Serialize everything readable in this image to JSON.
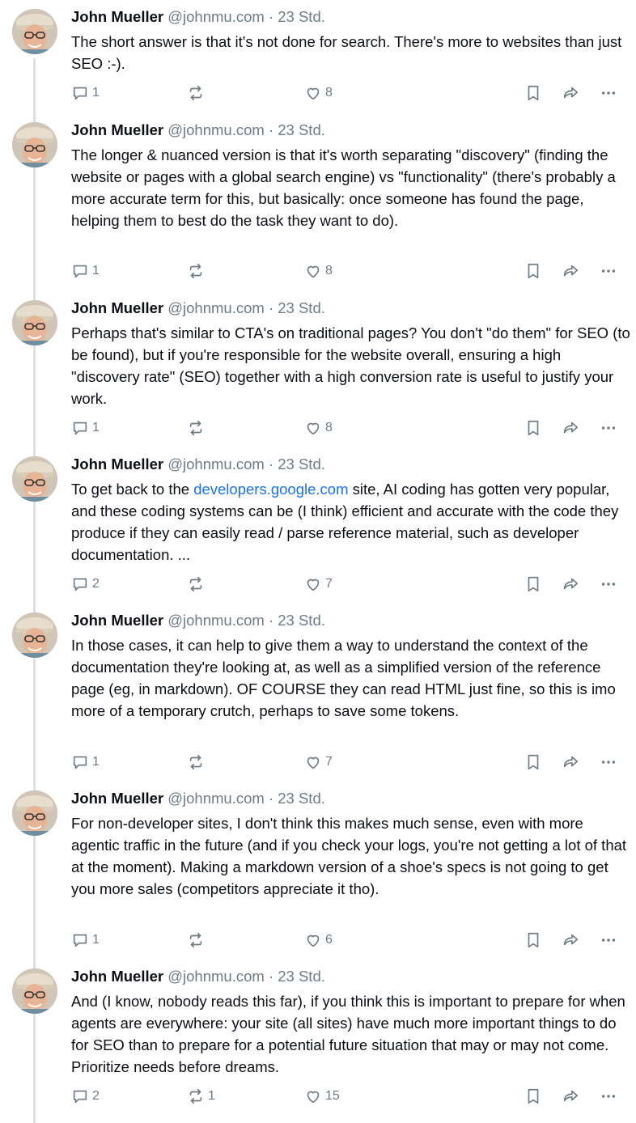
{
  "posts": [
    {
      "author": "John Mueller",
      "handle": "@johnmu.com",
      "separator": "·",
      "time": "23 Std.",
      "text": "The short answer is that it's not done for search. There's more to websites than just SEO :-).",
      "replies": "1",
      "reposts": "",
      "likes": "8"
    },
    {
      "author": "John Mueller",
      "handle": "@johnmu.com",
      "separator": "·",
      "time": "23 Std.",
      "text": "The longer & nuanced version is that it's worth separating \"discovery\" (finding the website or pages with a global search engine) vs \"functionality\" (there's probably a more accurate term for this, but basically: once someone has found the page, helping them to best do the task they want to do).",
      "replies": "1",
      "reposts": "",
      "likes": "8"
    },
    {
      "author": "John Mueller",
      "handle": "@johnmu.com",
      "separator": "·",
      "time": "23 Std.",
      "text": "Perhaps that's similar to CTA's on traditional pages? You don't \"do them\" for SEO (to be found), but if you're responsible for the website overall, ensuring a high \"discovery rate\" (SEO) together with a high conversion rate is useful to justify your work.",
      "replies": "1",
      "reposts": "",
      "likes": "8"
    },
    {
      "author": "John Mueller",
      "handle": "@johnmu.com",
      "separator": "·",
      "time": "23 Std.",
      "text_before": "To get back to the ",
      "link": "developers.google.com",
      "text_after": " site, AI coding has gotten very popular, and these coding systems can be (I think) efficient and accurate with the code they produce if they can easily read / parse reference material, such as developer documentation. ...",
      "replies": "2",
      "reposts": "",
      "likes": "7"
    },
    {
      "author": "John Mueller",
      "handle": "@johnmu.com",
      "separator": "·",
      "time": "23 Std.",
      "text": "In those cases, it can help to give them a way to understand the context of the documentation they're looking at, as well as a simplified version of the reference page (eg, in markdown). OF COURSE they can read HTML just fine, so this is imo more of a temporary crutch, perhaps to save some tokens.",
      "replies": "1",
      "reposts": "",
      "likes": "7"
    },
    {
      "author": "John Mueller",
      "handle": "@johnmu.com",
      "separator": "·",
      "time": "23 Std.",
      "text": "For non-developer sites, I don't think this makes much sense, even with more agentic traffic in the future (and if you check your logs, you're not getting a lot of that at the moment). Making a markdown version of a shoe's specs is not going to get you more sales (competitors appreciate it tho).",
      "replies": "1",
      "reposts": "",
      "likes": "6"
    },
    {
      "author": "John Mueller",
      "handle": "@johnmu.com",
      "separator": "·",
      "time": "23 Std.",
      "text": "And (I know, nobody reads this far), if you think this is important to prepare for when agents are everywhere: your site (all sites) have much more important things to do for SEO than to prepare for a potential future situation that may or may not come. Prioritize needs before dreams.",
      "replies": "2",
      "reposts": "1",
      "likes": "15"
    }
  ],
  "colors": {
    "text": "#0b0f14",
    "muted": "#6f7b87",
    "link": "#1a73e8",
    "thread": "#dbe1e7"
  },
  "icons": [
    "reply-icon",
    "repost-icon",
    "like-icon",
    "bookmark-icon",
    "share-icon",
    "more-icon"
  ]
}
